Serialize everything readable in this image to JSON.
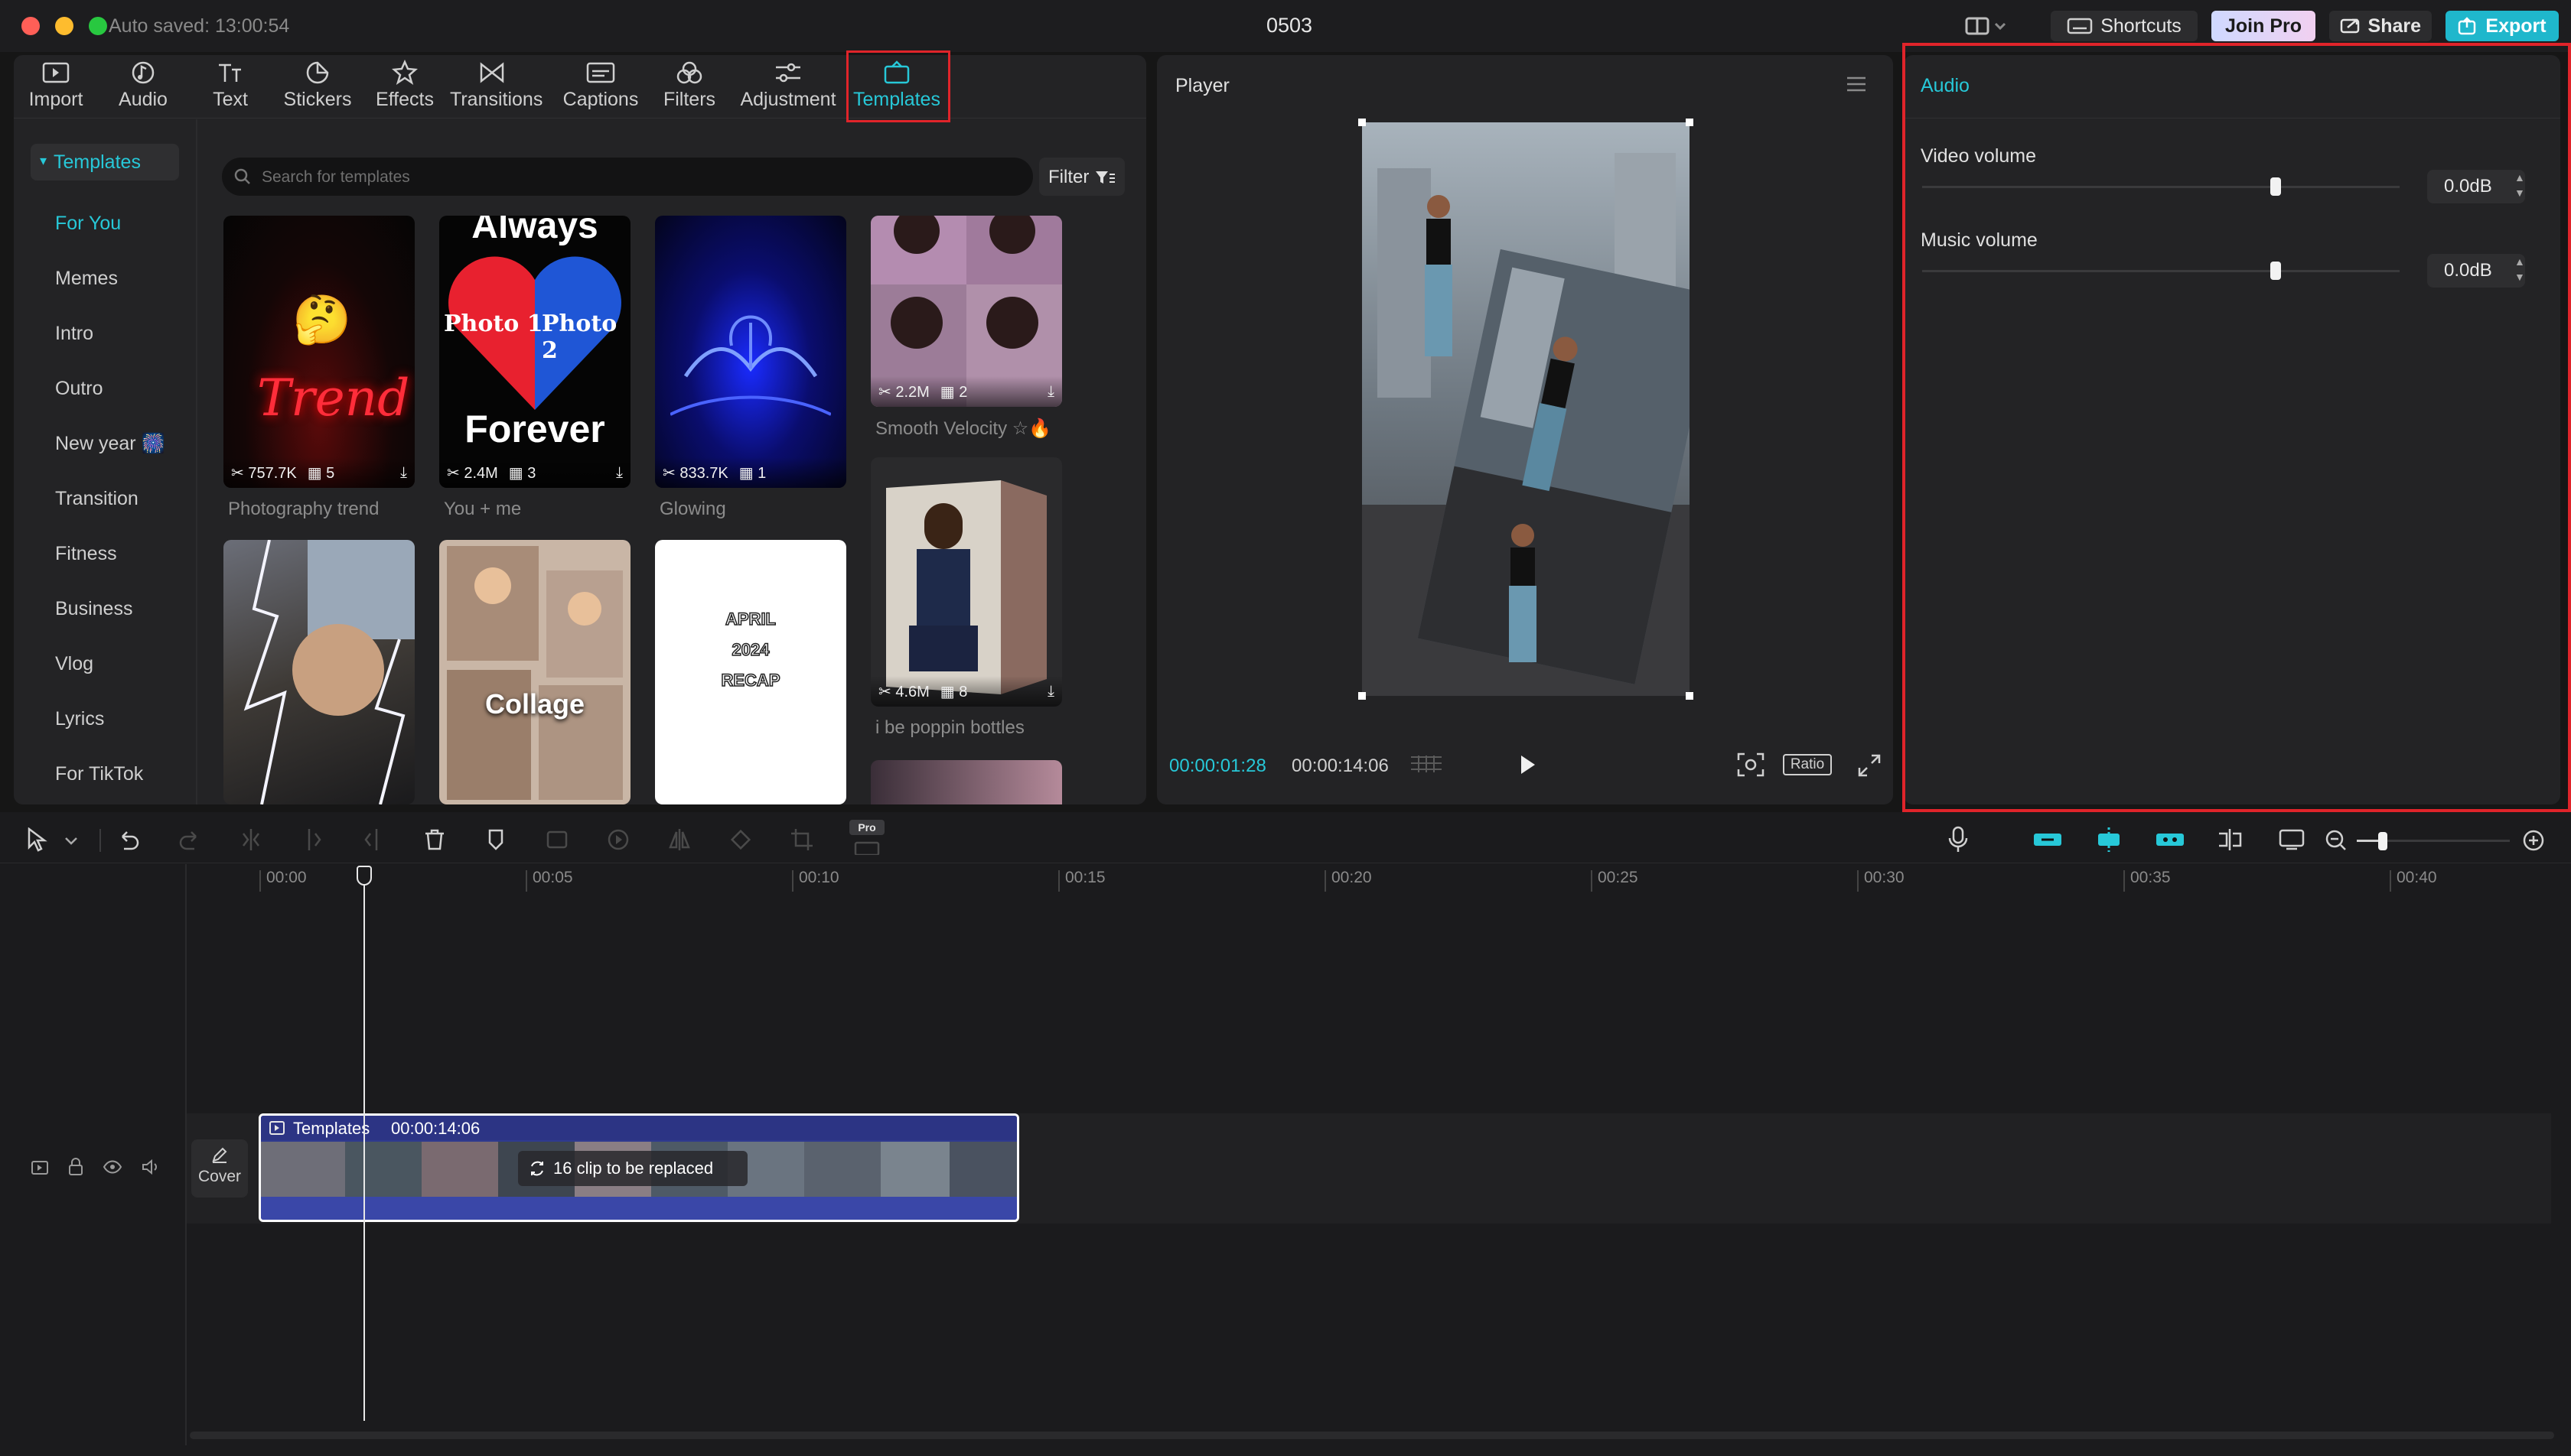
{
  "window": {
    "autosave": "Auto saved: 13:00:54",
    "title": "0503"
  },
  "titlebar": {
    "shortcuts": "Shortcuts",
    "join_pro": "Join Pro",
    "share": "Share",
    "export": "Export"
  },
  "toolbar": {
    "tabs": [
      {
        "label": "Import",
        "icon": "import-icon"
      },
      {
        "label": "Audio",
        "icon": "audio-icon"
      },
      {
        "label": "Text",
        "icon": "text-icon"
      },
      {
        "label": "Stickers",
        "icon": "stickers-icon"
      },
      {
        "label": "Effects",
        "icon": "effects-icon"
      },
      {
        "label": "Transitions",
        "icon": "transitions-icon"
      },
      {
        "label": "Captions",
        "icon": "captions-icon"
      },
      {
        "label": "Filters",
        "icon": "filters-icon"
      },
      {
        "label": "Adjustment",
        "icon": "adjustment-icon"
      },
      {
        "label": "Templates",
        "icon": "templates-icon",
        "active": true
      }
    ]
  },
  "sidebar": {
    "header": "Templates",
    "items": [
      "For You",
      "Memes",
      "Intro",
      "Outro",
      "New year 🎆",
      "Transition",
      "Fitness",
      "Business",
      "Vlog",
      "Lyrics",
      "For TikTok"
    ],
    "active_index": 0
  },
  "search": {
    "placeholder": "Search for templates",
    "filter": "Filter"
  },
  "templates": [
    {
      "title": "Photography trend",
      "uses": "757.7K",
      "clips": "5",
      "overlay": "Trend"
    },
    {
      "title": "You + me",
      "uses": "2.4M",
      "clips": "3",
      "overlay_top": "Always",
      "overlay_left": "Photo 1",
      "overlay_right": "Photo 2",
      "overlay_bottom": "Forever"
    },
    {
      "title": "Glowing",
      "uses": "833.7K",
      "clips": "1"
    },
    {
      "title": "Smooth Velocity ☆🔥",
      "uses": "2.2M",
      "clips": "2"
    },
    {
      "title": "i be poppin bottles",
      "uses": "4.6M",
      "clips": "8"
    },
    {
      "overlay": "Collage"
    },
    {
      "overlay_lines": [
        "APRIL",
        "2024",
        "RECAP"
      ]
    }
  ],
  "player": {
    "title": "Player",
    "current": "00:00:01:28",
    "total": "00:00:14:06",
    "ratio": "Ratio"
  },
  "audio": {
    "title": "Audio",
    "video_volume": {
      "label": "Video volume",
      "value": "0.0dB",
      "level": 0.74
    },
    "music_volume": {
      "label": "Music volume",
      "value": "0.0dB",
      "level": 0.74
    }
  },
  "timeline": {
    "pro_badge": "Pro",
    "ticks": [
      "00:00",
      "00:05",
      "00:10",
      "00:15",
      "00:20",
      "00:25",
      "00:30",
      "00:35",
      "00:40"
    ],
    "cover": "Cover",
    "clip": {
      "title": "Templates",
      "duration": "00:00:14:06",
      "replace": "16 clip to be replaced"
    }
  },
  "colors": {
    "accent": "#27c8d8",
    "highlight": "#e0242a",
    "clip": "#2f3a8f"
  }
}
